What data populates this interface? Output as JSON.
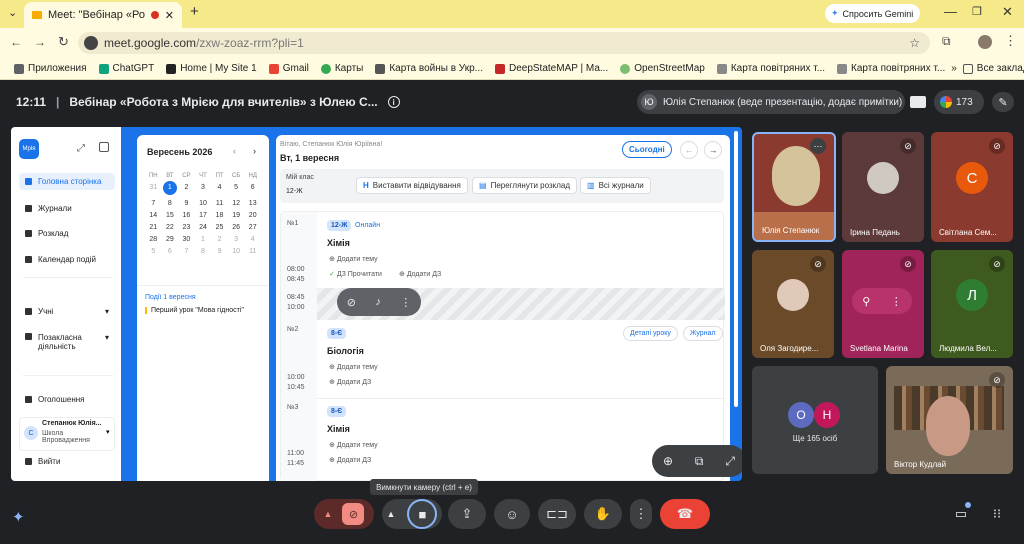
{
  "browser": {
    "tab_title": "Meet: \"Вебінар «Робота з М",
    "new_tab": "+",
    "gemini": "Спросить Gemini",
    "url_host": "meet.google.com",
    "url_path": "/zxw-zoaz-rrm?pli=1",
    "bookmarks": [
      "Приложения",
      "ChatGPT",
      "Home | My Site 1",
      "Gmail",
      "Карты",
      "Карта войны в Укр...",
      "DeepStateMAP | Ма...",
      "OpenStreetMap",
      "Карта повітряних т...",
      "Карта повітряних т..."
    ],
    "all_bookmarks": "Все закладки"
  },
  "meet": {
    "time": "12:11",
    "title": "Вебінар «Робота з Мрією для вчителів» з Юлею С...",
    "presenter": "Юлія Степанюк (веде презентацію, додає примітки)",
    "presenter_initial": "Ю",
    "participants_count": "173",
    "tooltip": "Вимкнути камеру (ctrl + e)"
  },
  "app": {
    "logo": "Мрія",
    "sidebar": [
      {
        "label": "Головна сторінка",
        "active": true
      },
      {
        "label": "Журнали"
      },
      {
        "label": "Розклад"
      },
      {
        "label": "Календар подій"
      },
      {
        "label": "Учні"
      },
      {
        "label": "Позакласна діяльність"
      },
      {
        "label": "Оголошення"
      }
    ],
    "user": {
      "initial": "С",
      "name": "Степанюк Юлія...",
      "school": "Школа Впровадження"
    },
    "logout": "Вийти",
    "calendar": {
      "month": "Вересень 2026",
      "weekdays": [
        "ПН",
        "ВТ",
        "СР",
        "ЧТ",
        "ПТ",
        "СБ",
        "НД"
      ],
      "days": [
        "31",
        "1",
        "2",
        "3",
        "4",
        "5",
        "6",
        "7",
        "8",
        "9",
        "10",
        "11",
        "12",
        "13",
        "14",
        "15",
        "16",
        "17",
        "18",
        "19",
        "20",
        "21",
        "22",
        "23",
        "24",
        "25",
        "26",
        "27",
        "28",
        "29",
        "30",
        "1",
        "2",
        "3",
        "4",
        "5",
        "6",
        "7",
        "8",
        "9",
        "10",
        "11"
      ],
      "events_header": "Події 1 вересня",
      "event": "Перший урок \"Мова гідності\""
    },
    "greeting": "Вітаю, Степанюк Юлія Юріївна!",
    "date": "Вт, 1 вересня",
    "today": "Сьогодні",
    "my_class_label": "Мій клас",
    "my_class": "12-Ж",
    "actions": [
      "Виставити відвідування",
      "Переглянути розклад",
      "Всі журнали"
    ],
    "lessons": [
      {
        "num": "№1",
        "class": "12-Ж",
        "mode": "Онлайн",
        "subject": "Хімія",
        "start": "08:00",
        "end": "08:45",
        "add_topic": "Додати тему",
        "hw": "ДЗ  Прочитати",
        "add_hw": "Додати ДЗ"
      },
      {
        "num": "№2",
        "class": "8-Є",
        "subject": "Біологія",
        "start": "10:00",
        "end": "10:45",
        "add_topic": "Додати тему",
        "add_hw": "Додати ДЗ",
        "details": "Деталі уроку",
        "journal": "Журнал"
      },
      {
        "num": "№3",
        "class": "8-Є",
        "subject": "Хімія",
        "start": "11:00",
        "end": "11:45",
        "add_topic": "Додати тему",
        "add_hw": "Додати ДЗ"
      }
    ],
    "break_start": "08:45",
    "break_end": "10:00"
  },
  "tiles": [
    {
      "name": "Юлія Степанюк"
    },
    {
      "name": "Ірина Педань"
    },
    {
      "name": "Світлана Сем...",
      "initial": "С",
      "color": "#e8590c"
    },
    {
      "name": "Оля Загодире..."
    },
    {
      "name": "Svetlana Marina"
    },
    {
      "name": "Людмила Вел...",
      "initial": "Л",
      "color": "#2e7d32"
    },
    {
      "name": "Ще 165 осіб",
      "initials": [
        "О",
        "Н"
      ]
    },
    {
      "name": "Віктор Кудлай"
    }
  ]
}
